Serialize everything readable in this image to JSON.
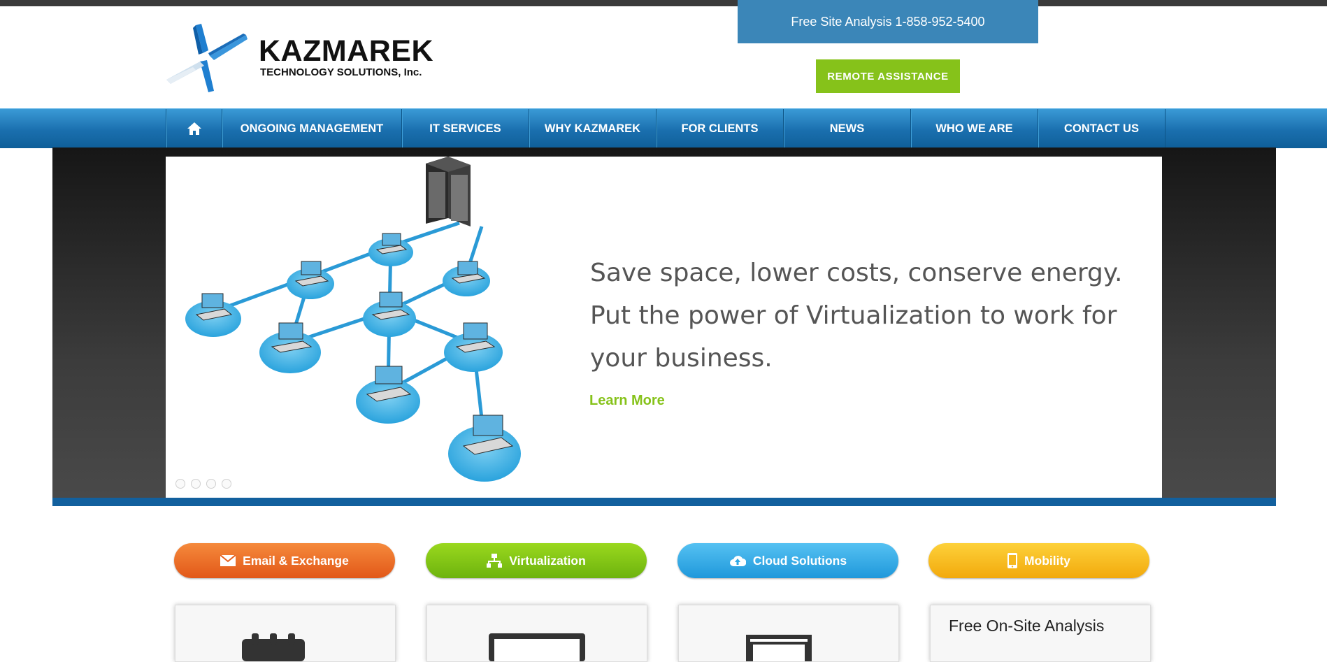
{
  "header": {
    "logo_name": "KAZMAREK",
    "logo_sub": "TECHNOLOGY SOLUTIONS, Inc.",
    "phone_text": "Free Site Analysis 1-858-952-5400",
    "remote_label": "REMOTE ASSISTANCE"
  },
  "nav": {
    "home_icon": "home-icon",
    "items": [
      {
        "label": "ONGOING MANAGEMENT"
      },
      {
        "label": "IT SERVICES"
      },
      {
        "label": "WHY KAZMAREK"
      },
      {
        "label": "FOR CLIENTS"
      },
      {
        "label": "NEWS"
      },
      {
        "label": "WHO WE ARE"
      },
      {
        "label": "CONTACT US"
      }
    ]
  },
  "hero": {
    "headline": "Save space, lower costs, conserve energy. Put the power of Virtualization to work for your business.",
    "cta": "Learn More",
    "slide_count": 4
  },
  "services": [
    {
      "label": "Email & Exchange",
      "icon": "envelope-icon",
      "color": "#e8601c"
    },
    {
      "label": "Virtualization",
      "icon": "network-icon",
      "color": "#7fc414"
    },
    {
      "label": "Cloud Solutions",
      "icon": "cloud-upload-icon",
      "color": "#2ea8e6"
    },
    {
      "label": "Mobility",
      "icon": "phone-icon",
      "color": "#f6b81e"
    }
  ],
  "cards": {
    "analysis_title": "Free On-Site Analysis",
    "icons": [
      "calendar-icon",
      "monitor-icon",
      "server-icon"
    ]
  },
  "colors": {
    "nav_blue": "#1a6fae",
    "accent_green": "#86c21a",
    "phone_box": "#3b86b8"
  }
}
